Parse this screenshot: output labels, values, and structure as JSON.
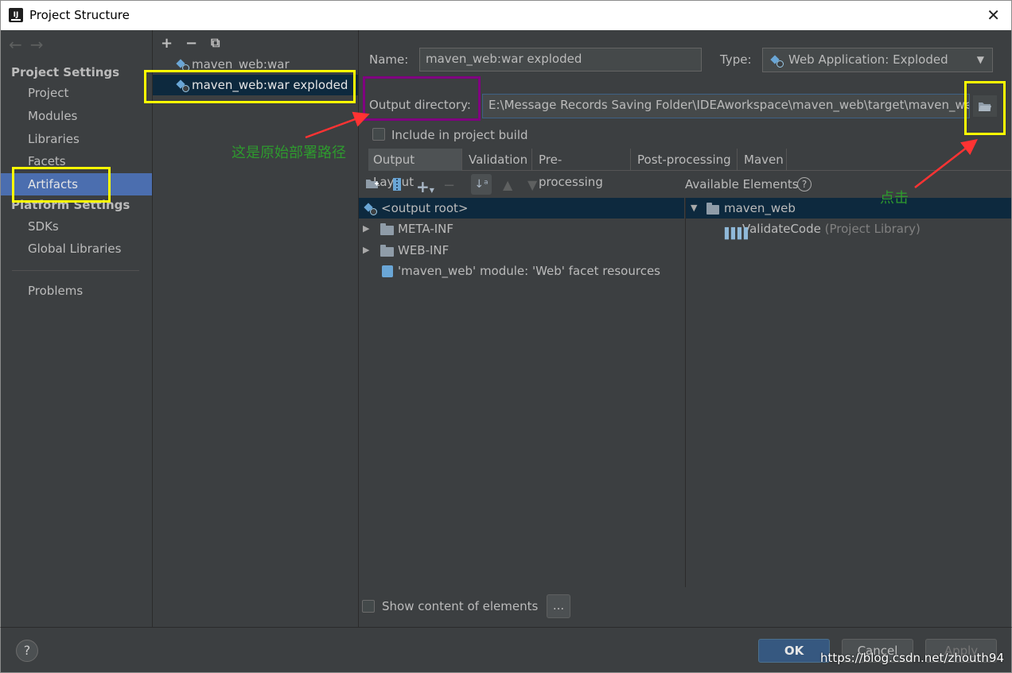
{
  "window": {
    "title": "Project Structure",
    "app_icon_text": "IJ"
  },
  "nav": {
    "back_label": "←",
    "forward_label": "→",
    "project_settings_title": "Project Settings",
    "project_settings_items": [
      "Project",
      "Modules",
      "Libraries",
      "Facets",
      "Artifacts"
    ],
    "platform_settings_title": "Platform Settings",
    "platform_settings_items": [
      "SDKs",
      "Global Libraries"
    ],
    "problems_label": "Problems",
    "selected": "Artifacts"
  },
  "artifacts": {
    "toolbar": {
      "add": "+",
      "remove": "−",
      "copy": "⧉"
    },
    "items": [
      "maven_web:war",
      "maven_web:war exploded"
    ],
    "selected": "maven_web:war exploded"
  },
  "details": {
    "name_label": "Name:",
    "name_value": "maven_web:war exploded",
    "type_label": "Type:",
    "type_value": "Web Application: Exploded",
    "output_dir_label": "Output directory:",
    "output_dir_value": "E:\\Message Records Saving Folder\\IDEAworkspace\\maven_web\\target\\maven_web",
    "include_build_label": "Include in project build",
    "include_build_checked": false,
    "tabs": [
      "Output Layout",
      "Validation",
      "Pre-processing",
      "Post-processing",
      "Maven"
    ],
    "active_tab": "Output Layout",
    "available_elements_label": "Available Elements",
    "layout_tree": [
      {
        "label": "<output root>",
        "type": "root"
      },
      {
        "label": "META-INF",
        "type": "folder"
      },
      {
        "label": "WEB-INF",
        "type": "folder"
      },
      {
        "label": "'maven_web' module: 'Web' facet resources",
        "type": "facet"
      }
    ],
    "available_tree": {
      "module": "maven_web",
      "library_name": "ValidateCode",
      "library_suffix": "(Project Library)"
    },
    "show_content_label": "Show content of elements",
    "ellipsis_label": "..."
  },
  "buttons": {
    "ok": "OK",
    "cancel": "Cancel",
    "apply": "Apply",
    "help": "?"
  },
  "annotations": {
    "original_path_note": "这是原始部署路径",
    "click_note": "点击"
  },
  "watermark": "https://blog.csdn.net/zhouth94",
  "colors": {
    "background": "#3c3f41",
    "selection": "#4b6eaf",
    "tree_selection": "#0d293e",
    "highlight_yellow": "#ffff00",
    "highlight_purple": "#800080",
    "annotation_arrow": "#ff3333",
    "annotation_text": "#2e9a2e"
  }
}
